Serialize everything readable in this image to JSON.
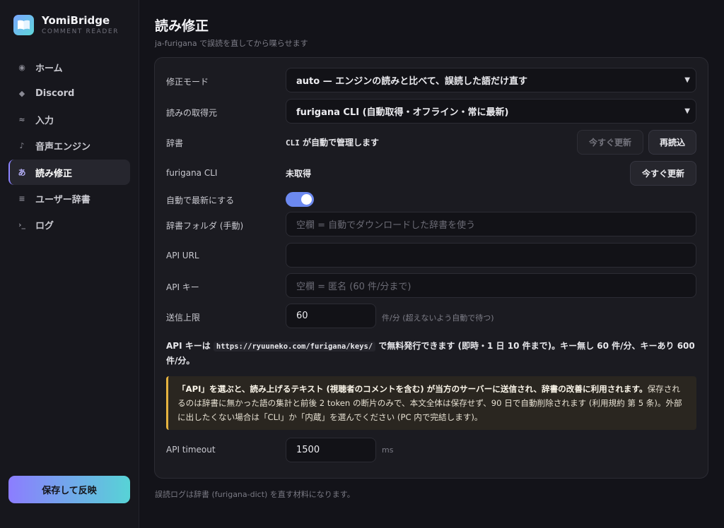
{
  "brand": {
    "title": "YomiBridge",
    "subtitle": "COMMENT READER",
    "accent": "#6fb6ff"
  },
  "nav": [
    {
      "icon": "circle-dot-icon",
      "glyph": "◉",
      "label": "ホーム",
      "active": false
    },
    {
      "icon": "diamond-icon",
      "glyph": "◆",
      "label": "Discord",
      "active": false
    },
    {
      "icon": "wave-icon",
      "glyph": "≈",
      "label": "入力",
      "active": false
    },
    {
      "icon": "music-note-icon",
      "glyph": "♪",
      "label": "音声エンジン",
      "active": false
    },
    {
      "icon": "kana-a-icon",
      "glyph": "あ",
      "label": "読み修正",
      "active": true
    },
    {
      "icon": "list-icon",
      "glyph": "≡",
      "label": "ユーザー辞書",
      "active": false
    },
    {
      "icon": "terminal-icon",
      "glyph": "›_",
      "label": "ログ",
      "active": false
    }
  ],
  "save_button": "保存して反映",
  "page": {
    "title": "読み修正",
    "subtitle": "ja-furigana で誤読を直してから喋らせます"
  },
  "form": {
    "mode": {
      "label": "修正モード",
      "value": "auto — エンジンの読みと比べて、誤読した語だけ直す"
    },
    "source": {
      "label": "読みの取得元",
      "value": "furigana CLI (自動取得・オフライン・常に最新)"
    },
    "dictionary": {
      "label": "辞書",
      "value_code": "CLI",
      "value_text": " が自動で管理します",
      "update_now": "今すぐ更新",
      "reload": "再読込"
    },
    "cli": {
      "label": "furigana CLI",
      "value": "未取得",
      "update_now": "今すぐ更新"
    },
    "auto_update": {
      "label": "自動で最新にする",
      "on": true
    },
    "dict_folder": {
      "label": "辞書フォルダ (手動)",
      "placeholder": "空欄 = 自動でダウンロードした辞書を使う"
    },
    "api_url": {
      "label": "API URL",
      "value": ""
    },
    "api_key": {
      "label": "API キー",
      "placeholder": "空欄 = 匿名 (60 件/分まで)"
    },
    "rate_limit": {
      "label": "送信上限",
      "value": "60",
      "unit": "件/分 (超えないよう自動で待つ)"
    },
    "api_note": {
      "prefix": "API キーは ",
      "url": "https://ryuuneko.com/furigana/keys/",
      "suffix": " で無料発行できます (即時・1 日 10 件まで)。キー無し 60 件/分、キーあり 600 件/分。"
    },
    "warning": {
      "strong": "「API」を選ぶと、読み上げるテキスト (視聴者のコメントを含む) が当方のサーバーに送信され、辞書の改善に利用されます。",
      "body": "保存されるのは辞書に無かった語の集計と前後 2 token の断片のみで、本文全体は保存せず、90 日で自動削除されます (利用規約 第 5 条)。外部に出したくない場合は「CLI」か「内蔵」を選んでください (PC 内で完結します)。",
      "color": "#e6b340"
    },
    "api_timeout": {
      "label": "API timeout",
      "value": "1500",
      "unit": "ms"
    }
  },
  "footer_note": "誤読ログは辞書 (furigana-dict) を直す材料になります。"
}
